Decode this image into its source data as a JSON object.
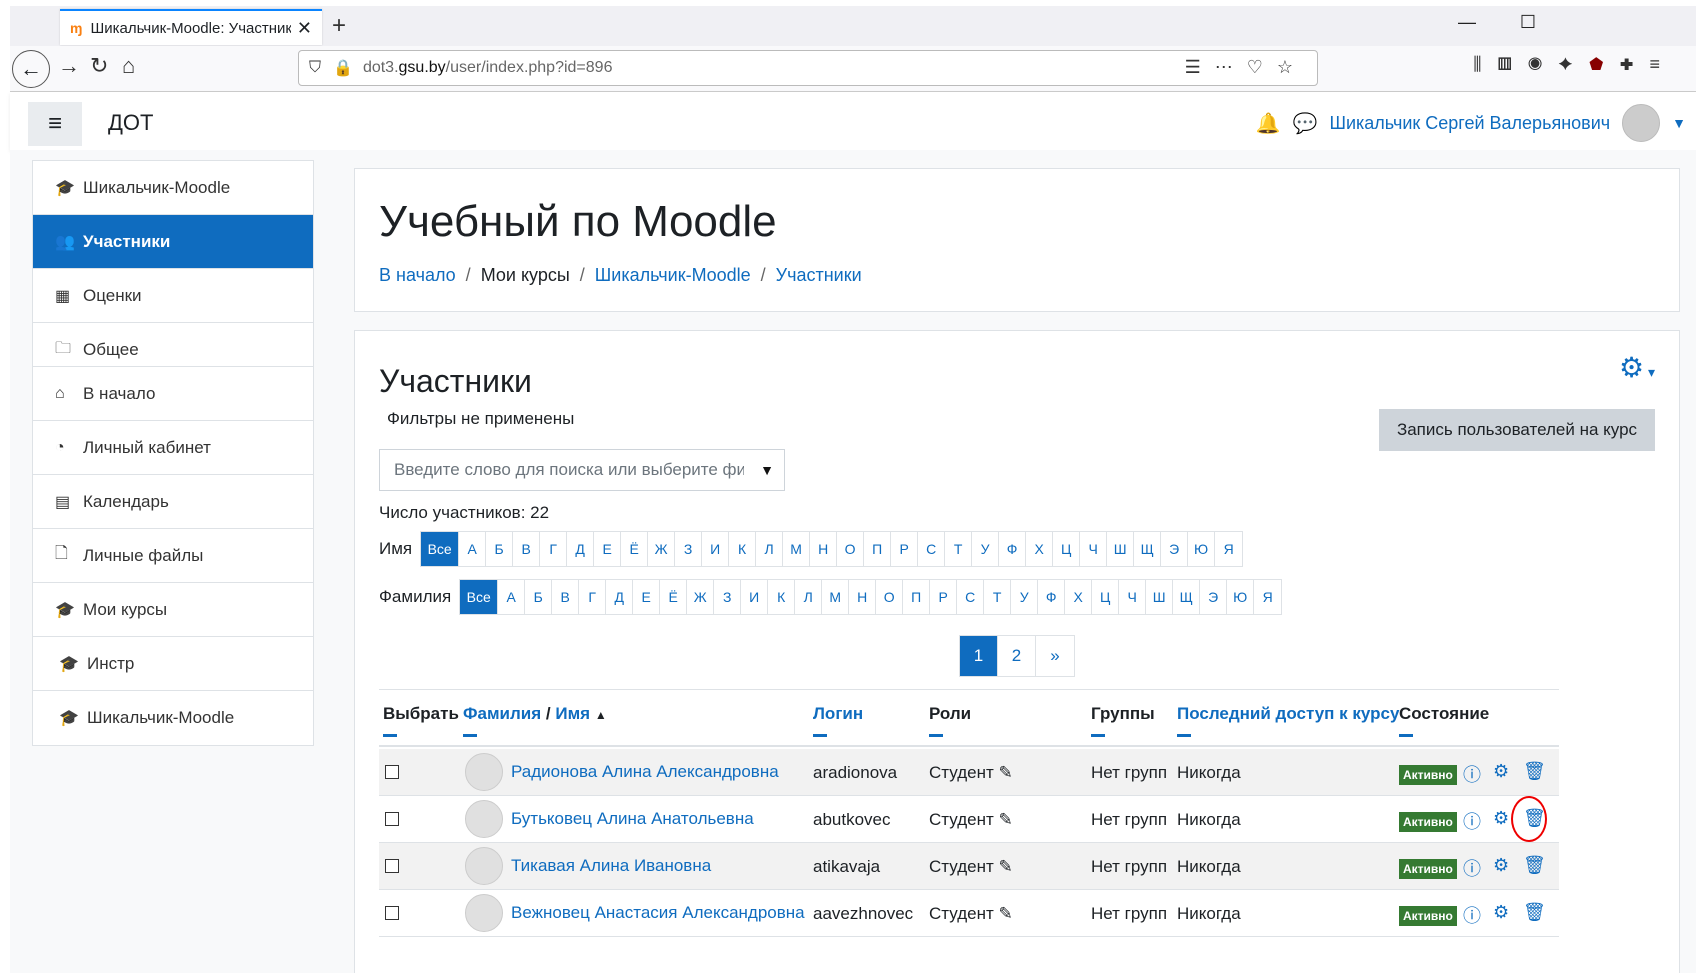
{
  "browser": {
    "tab_title": "Шикальчик-Moodle: Участник",
    "url_prefix": "dot3.",
    "url_domain": "gsu.by",
    "url_path": "/user/index.php?id=896"
  },
  "header": {
    "brand": "ДОТ",
    "user_name": "Шикальчик Сергей Валерьянович"
  },
  "sidebar": {
    "block1": [
      {
        "label": "Шикальчик-Moodle",
        "icon": "graduation-cap-icon",
        "active": false
      },
      {
        "label": "Участники",
        "icon": "users-icon",
        "active": true
      },
      {
        "label": "Оценки",
        "icon": "table-icon",
        "active": false
      },
      {
        "label": "Общее",
        "icon": "folder-icon",
        "active": false
      }
    ],
    "block2": [
      {
        "label": "В начало",
        "icon": "home-icon"
      },
      {
        "label": "Личный кабинет",
        "icon": "dashboard-icon"
      },
      {
        "label": "Календарь",
        "icon": "calendar-icon"
      },
      {
        "label": "Личные файлы",
        "icon": "file-icon"
      },
      {
        "label": "Мои курсы",
        "icon": "graduation-cap-icon"
      },
      {
        "label": "Инстр",
        "icon": "graduation-cap-icon"
      },
      {
        "label": "Шикальчик-Moodle",
        "icon": "graduation-cap-icon"
      }
    ]
  },
  "course": {
    "title": "Учебный по Moodle",
    "breadcrumb": [
      "В начало",
      "Мои курсы",
      "Шикальчик-Moodle",
      "Участники"
    ]
  },
  "participants": {
    "title": "Участники",
    "no_filters": "Фильтры не применены",
    "enrol_button": "Запись пользователей на курс",
    "search_placeholder": "Введите слово для поиска или выберите фильтр",
    "count_text": "Число участников: 22",
    "firstname_label": "Имя",
    "lastname_label": "Фамилия",
    "all_label": "Все",
    "letters": [
      "А",
      "Б",
      "В",
      "Г",
      "Д",
      "Е",
      "Ё",
      "Ж",
      "З",
      "И",
      "К",
      "Л",
      "М",
      "Н",
      "О",
      "П",
      "Р",
      "С",
      "Т",
      "У",
      "Ф",
      "Х",
      "Ц",
      "Ч",
      "Ш",
      "Щ",
      "Э",
      "Ю",
      "Я"
    ],
    "pages": [
      "1",
      "2",
      "»"
    ],
    "columns": {
      "select": "Выбрать",
      "lastname": "Фамилия",
      "slash": "/",
      "firstname": "Имя",
      "login": "Логин",
      "roles": "Роли",
      "groups": "Группы",
      "last_access": "Последний доступ к курсу",
      "status": "Состояние"
    },
    "rows": [
      {
        "name": "Радионова Алина Александровна",
        "login": "aradionova",
        "role": "Студент",
        "groups": "Нет групп",
        "access": "Никогда",
        "status": "Активно"
      },
      {
        "name": "Бутьковец Алина Анатольевна",
        "login": "abutkovec",
        "role": "Студент",
        "groups": "Нет групп",
        "access": "Никогда",
        "status": "Активно"
      },
      {
        "name": "Тикавая Алина Ивановна",
        "login": "atikavaja",
        "role": "Студент",
        "groups": "Нет групп",
        "access": "Никогда",
        "status": "Активно"
      },
      {
        "name": "Вежновец Анастасия Александровна",
        "login": "aavezhnovec",
        "role": "Студент",
        "groups": "Нет групп",
        "access": "Никогда",
        "status": "Активно"
      }
    ]
  },
  "colors": {
    "accent": "#0f6cbf",
    "active_badge": "#357a32",
    "annotation": "#e00000"
  }
}
